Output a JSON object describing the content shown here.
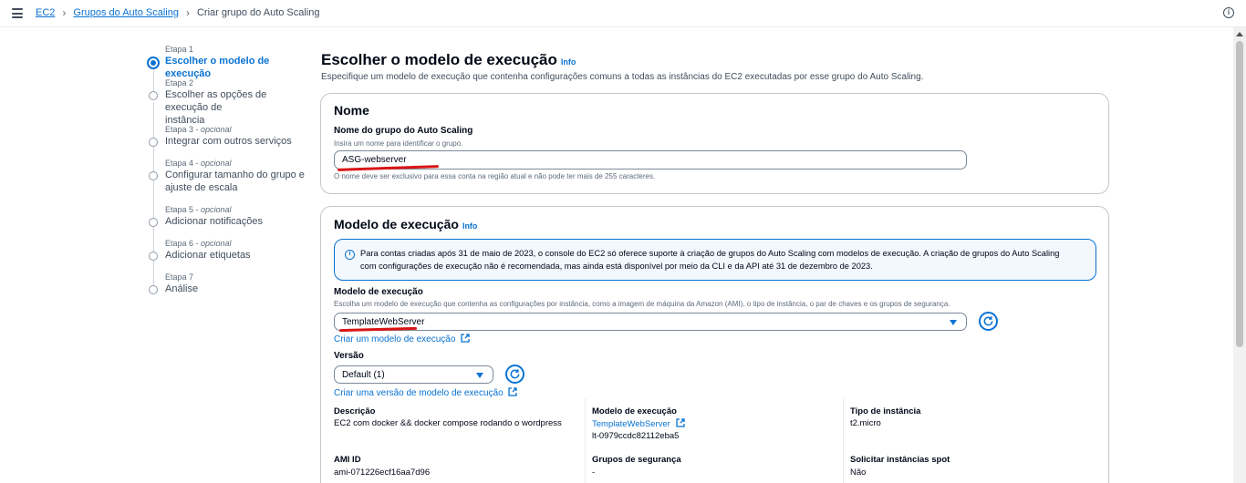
{
  "breadcrumbs": [
    "EC2",
    "Grupos do Auto Scaling",
    "Criar grupo do Auto Scaling"
  ],
  "steps": [
    {
      "num": "Etapa 1",
      "optional": "",
      "title": "Escolher o modelo de execução",
      "active": true
    },
    {
      "num": "Etapa 2",
      "optional": "",
      "title_line1": "Escolher as opções de execução de",
      "title_line2": "instância"
    },
    {
      "num": "Etapa 3",
      "optional": "opcional",
      "title": "Integrar com outros serviços"
    },
    {
      "num": "Etapa 4",
      "optional": "opcional",
      "title_line1": "Configurar tamanho do grupo e",
      "title_line2": "ajuste de escala"
    },
    {
      "num": "Etapa 5",
      "optional": "opcional",
      "title": "Adicionar notificações"
    },
    {
      "num": "Etapa 6",
      "optional": "opcional",
      "title": "Adicionar etiquetas"
    },
    {
      "num": "Etapa 7",
      "optional": "",
      "title": "Análise"
    }
  ],
  "page": {
    "title": "Escolher o modelo de execução",
    "info": "Info",
    "description": "Especifique um modelo de execução que contenha configurações comuns a todas as instâncias do EC2 executadas por esse grupo do Auto Scaling."
  },
  "name_panel": {
    "title": "Nome",
    "field_label": "Nome do grupo do Auto Scaling",
    "field_hint": "Insira um nome para identificar o grupo.",
    "field_value": "ASG-webserver",
    "field_constraint": "O nome deve ser exclusivo para essa conta na região atual e não pode ter mais de 255 caracteres."
  },
  "template_panel": {
    "title": "Modelo de execução",
    "info": "Info",
    "alert_line1": "Para contas criadas após 31 de maio de 2023, o console do EC2 só oferece suporte à criação de grupos do Auto Scaling com modelos de execução. A criação de grupos do Auto Scaling",
    "alert_line2": "com configurações de execução não é recomendada, mas ainda está disponível por meio da CLI e da API até 31 de dezembro de 2023.",
    "template_label": "Modelo de execução",
    "template_hint": "Escolha um modelo de execução que contenha as configurações por instância, como a imagem de máquina da Amazon (AMI), o tipo de instância, o par de chaves e os grupos de segurança.",
    "template_value": "TemplateWebServer",
    "create_template_link": "Criar um modelo de execução",
    "version_label": "Versão",
    "version_value": "Default (1)",
    "create_version_link": "Criar uma versão de modelo de execução",
    "details": {
      "description_label": "Descrição",
      "description_value": "EC2 com docker && docker compose rodando o wordpress",
      "template_label": "Modelo de execução",
      "template_link": "TemplateWebServer",
      "template_id": "lt-0979ccdc82112eba5",
      "instance_type_label": "Tipo de instância",
      "instance_type_value": "t2.micro",
      "ami_label": "AMI ID",
      "ami_value": "ami-071226ecf16aa7d96",
      "security_groups_label": "Grupos de segurança",
      "security_groups_value": "-",
      "spot_label": "Solicitar instâncias spot",
      "spot_value": "Não"
    }
  },
  "colors": {
    "accent": "#0972d3",
    "annotation": "#d91515"
  }
}
